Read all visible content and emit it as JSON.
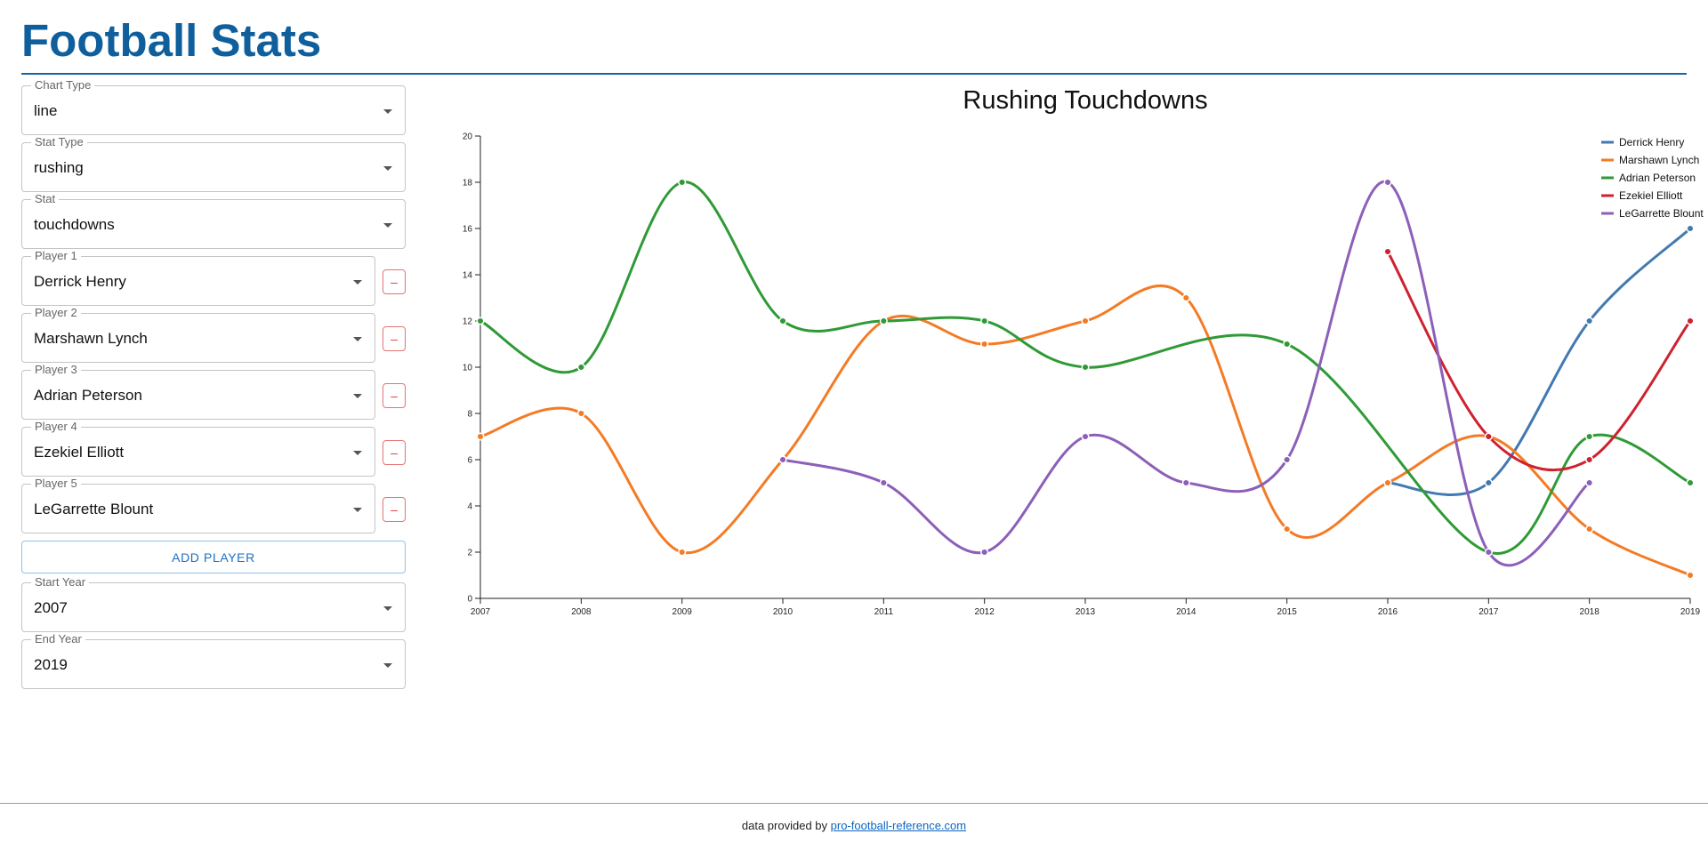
{
  "app": {
    "title": "Football Stats"
  },
  "controls": {
    "chart_type": {
      "label": "Chart Type",
      "value": "line"
    },
    "stat_type": {
      "label": "Stat Type",
      "value": "rushing"
    },
    "stat": {
      "label": "Stat",
      "value": "touchdowns"
    },
    "players": [
      {
        "label": "Player 1",
        "value": "Derrick Henry"
      },
      {
        "label": "Player 2",
        "value": "Marshawn Lynch"
      },
      {
        "label": "Player 3",
        "value": "Adrian Peterson"
      },
      {
        "label": "Player 4",
        "value": "Ezekiel Elliott"
      },
      {
        "label": "Player 5",
        "value": "LeGarrette Blount"
      }
    ],
    "remove_label": "–",
    "add_player_label": "ADD PLAYER",
    "start_year": {
      "label": "Start Year",
      "value": "2007"
    },
    "end_year": {
      "label": "End Year",
      "value": "2019"
    }
  },
  "icons": {
    "dropdown": "chevron-down-icon",
    "remove": "minus-icon"
  },
  "footer": {
    "prefix": "data provided by",
    "link_text": "pro-football-reference.com"
  },
  "colors": {
    "brand": "#0f5f9c",
    "derrick_henry": "#4279b0",
    "marshawn_lynch": "#f47b25",
    "adrian_peterson": "#2f9a36",
    "ezekiel_elliott": "#cf2130",
    "legarrette_blount": "#8c5fb8"
  },
  "chart_data": {
    "type": "line",
    "title": "Rushing Touchdowns",
    "xlabel": "",
    "ylabel": "",
    "x": [
      2007,
      2008,
      2009,
      2010,
      2011,
      2012,
      2013,
      2014,
      2015,
      2016,
      2017,
      2018,
      2019
    ],
    "ylim": [
      0,
      20
    ],
    "yticks": [
      0,
      2,
      4,
      6,
      8,
      10,
      12,
      14,
      16,
      18,
      20
    ],
    "grid": false,
    "legend": "top-right",
    "series": [
      {
        "name": "Derrick Henry",
        "color": "#4279b0",
        "points": [
          [
            2016,
            5
          ],
          [
            2017,
            5
          ],
          [
            2018,
            12
          ],
          [
            2019,
            16
          ]
        ]
      },
      {
        "name": "Marshawn Lynch",
        "color": "#f47b25",
        "points": [
          [
            2007,
            7
          ],
          [
            2008,
            8
          ],
          [
            2009,
            2
          ],
          [
            2010,
            6
          ],
          [
            2011,
            12
          ],
          [
            2012,
            11
          ],
          [
            2013,
            12
          ],
          [
            2014,
            13
          ],
          [
            2015,
            3
          ],
          [
            2016,
            5
          ],
          [
            2017,
            7
          ],
          [
            2018,
            3
          ],
          [
            2019,
            1
          ]
        ]
      },
      {
        "name": "Adrian Peterson",
        "color": "#2f9a36",
        "points": [
          [
            2007,
            12
          ],
          [
            2008,
            10
          ],
          [
            2009,
            18
          ],
          [
            2010,
            12
          ],
          [
            2011,
            12
          ],
          [
            2012,
            12
          ],
          [
            2013,
            10
          ],
          [
            2015,
            11
          ],
          [
            2017,
            2
          ],
          [
            2018,
            7
          ],
          [
            2019,
            5
          ]
        ]
      },
      {
        "name": "Ezekiel Elliott",
        "color": "#cf2130",
        "points": [
          [
            2016,
            15
          ],
          [
            2017,
            7
          ],
          [
            2018,
            6
          ],
          [
            2019,
            12
          ]
        ]
      },
      {
        "name": "LeGarrette Blount",
        "color": "#8c5fb8",
        "points": [
          [
            2010,
            6
          ],
          [
            2011,
            5
          ],
          [
            2012,
            2
          ],
          [
            2013,
            7
          ],
          [
            2014,
            5
          ],
          [
            2015,
            6
          ],
          [
            2016,
            18
          ],
          [
            2017,
            2
          ],
          [
            2018,
            5
          ]
        ]
      }
    ]
  }
}
